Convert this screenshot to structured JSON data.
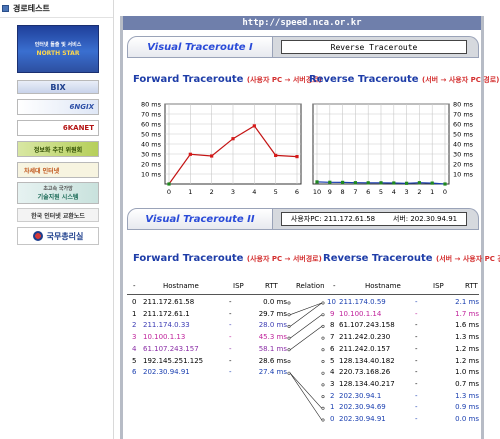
{
  "sidebar": {
    "header": "경로테스트",
    "banners": {
      "north_sub": "인터넷 돌출 및 서비스",
      "north": "NORTH STAR",
      "bix": "BIX",
      "ngix": "6NGIX",
      "kanet": "6KANET",
      "info": "정보화 추진 위원회",
      "next": "차세대 인터넷",
      "tech_sub": "초고속 국가망",
      "tech": "기술지원 시스템",
      "kix": "한국 인터넷 교환노드",
      "gov": "국무총리실"
    }
  },
  "main": {
    "url": "http://speed.nca.or.kr",
    "tab1": {
      "label": "Visual Traceroute I",
      "button": "Reverse Traceroute"
    },
    "forward_title": "Forward Traceroute",
    "forward_sub": "(사용자 PC → 서버경로)",
    "reverse_title": "Reverse Traceroute",
    "reverse_sub": "(서버 → 사용자 PC 경로)",
    "tab2": {
      "label": "Visual Traceroute II"
    },
    "user_pc_label": "사용자PC: 211.172.61.58",
    "server_label": "서버: 202.30.94.91",
    "forward_title2": "Forward Traceroute",
    "forward_sub2": "(사용자 PC → 서버경로)",
    "reverse_title2": "Reverse Traceroute",
    "reverse_sub2": "(서버 → 사용자 PC 경로)"
  },
  "colors": {
    "forward_line": "#c41414",
    "reverse_line": "#1a3fb0",
    "accent": "#1e3da8",
    "tab_bar": "#6f7fab"
  },
  "chart_data": [
    {
      "type": "line",
      "title": "Forward Traceroute",
      "x": [
        0,
        1,
        2,
        3,
        4,
        5,
        6
      ],
      "y": [
        0,
        29.7,
        28.0,
        45.3,
        58.1,
        28.6,
        27.4
      ],
      "ylim": [
        0,
        80
      ],
      "y_ticks": [
        "10 ms",
        "20 ms",
        "30 ms",
        "40 ms",
        "50 ms",
        "60 ms",
        "70 ms",
        "80 ms"
      ],
      "grid": true
    },
    {
      "type": "line",
      "title": "Reverse Traceroute",
      "x": [
        10,
        9,
        8,
        7,
        6,
        5,
        4,
        3,
        2,
        1,
        0
      ],
      "y": [
        2.1,
        1.7,
        1.6,
        1.3,
        1.2,
        1.2,
        1.0,
        0.7,
        1.3,
        0.9,
        0.0
      ],
      "ylim": [
        0,
        80
      ],
      "y_ticks": [
        "10 ms",
        "20 ms",
        "30 ms",
        "40 ms",
        "50 ms",
        "60 ms",
        "70 ms",
        "80 ms"
      ],
      "grid": true
    }
  ],
  "table": {
    "headers": {
      "f_idx": "-",
      "f_host": "Hostname",
      "f_isp": "ISP",
      "f_rtt": "RTT",
      "relation": "Relation",
      "r_idx": "-",
      "r_host": "Hostname",
      "r_isp": "ISP",
      "r_rtt": "RTT"
    },
    "forward": [
      {
        "idx": "0",
        "host": "211.172.61.58",
        "isp": "-",
        "rtt": "0.0 ms",
        "color": "#000000"
      },
      {
        "idx": "1",
        "host": "211.172.61.1",
        "isp": "-",
        "rtt": "29.7 ms",
        "color": "#000000"
      },
      {
        "idx": "2",
        "host": "211.174.0.33",
        "isp": "-",
        "rtt": "28.0 ms",
        "color": "#3c3cb4"
      },
      {
        "idx": "3",
        "host": "10.100.1.13",
        "isp": "-",
        "rtt": "45.3 ms",
        "color": "#c0249c"
      },
      {
        "idx": "4",
        "host": "61.107.243.157",
        "isp": "-",
        "rtt": "58.1 ms",
        "color": "#8a2da6"
      },
      {
        "idx": "5",
        "host": "192.145.251.125",
        "isp": "-",
        "rtt": "28.6 ms",
        "color": "#000000"
      },
      {
        "idx": "6",
        "host": "202.30.94.91",
        "isp": "-",
        "rtt": "27.4 ms",
        "color": "#1a3fb0"
      }
    ],
    "reverse": [
      {
        "idx": "10",
        "host": "211.174.0.59",
        "isp": "-",
        "rtt": "2.1 ms",
        "color": "#1a3fb0"
      },
      {
        "idx": "9",
        "host": "10.100.1.14",
        "isp": "-",
        "rtt": "1.7 ms",
        "color": "#c0249c"
      },
      {
        "idx": "8",
        "host": "61.107.243.158",
        "isp": "-",
        "rtt": "1.6 ms",
        "color": "#000000"
      },
      {
        "idx": "7",
        "host": "211.242.0.230",
        "isp": "-",
        "rtt": "1.3 ms",
        "color": "#000000"
      },
      {
        "idx": "6",
        "host": "211.242.0.157",
        "isp": "-",
        "rtt": "1.2 ms",
        "color": "#000000"
      },
      {
        "idx": "5",
        "host": "128.134.40.182",
        "isp": "-",
        "rtt": "1.2 ms",
        "color": "#000000"
      },
      {
        "idx": "4",
        "host": "220.73.168.26",
        "isp": "-",
        "rtt": "1.0 ms",
        "color": "#000000"
      },
      {
        "idx": "3",
        "host": "128.134.40.217",
        "isp": "-",
        "rtt": "0.7 ms",
        "color": "#000000"
      },
      {
        "idx": "2",
        "host": "202.30.94.1",
        "isp": "-",
        "rtt": "1.3 ms",
        "color": "#1a3fb0"
      },
      {
        "idx": "1",
        "host": "202.30.94.69",
        "isp": "-",
        "rtt": "0.9 ms",
        "color": "#1a3fb0"
      },
      {
        "idx": "0",
        "host": "202.30.94.91",
        "isp": "-",
        "rtt": "0.0 ms",
        "color": "#1a3fb0"
      }
    ],
    "relations": [
      {
        "from": 1,
        "to": 0
      },
      {
        "from": 2,
        "to": 0
      },
      {
        "from": 3,
        "to": 1
      },
      {
        "from": 4,
        "to": 2
      },
      {
        "from": 6,
        "to": 9
      },
      {
        "from": 6,
        "to": 10
      }
    ]
  }
}
